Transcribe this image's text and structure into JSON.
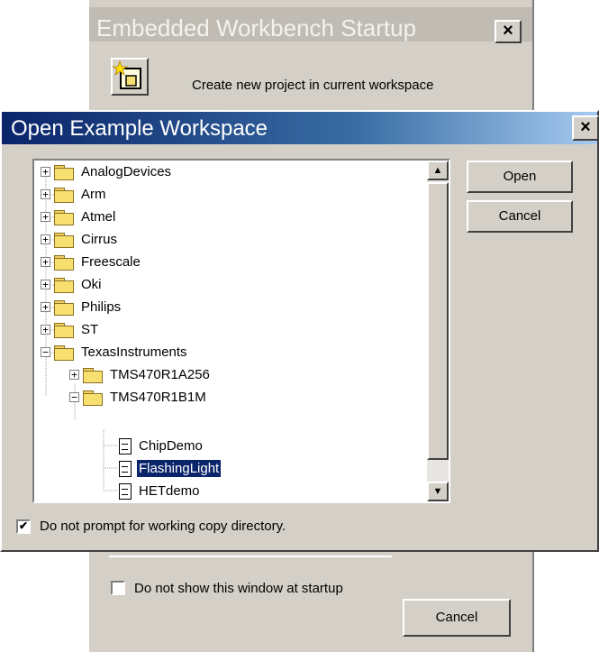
{
  "startup_dialog": {
    "title": "Embedded Workbench Startup",
    "close_label": "×",
    "create_project_text": "Create new project in current workspace",
    "checkbox_label": "Do not show this window at startup",
    "checkbox_checked": false,
    "cancel_label": "Cancel"
  },
  "example_dialog": {
    "title": "Open Example Workspace",
    "close_label": "×",
    "tree": {
      "items": [
        {
          "label": "AnalogDevices",
          "expander": "+"
        },
        {
          "label": "Arm",
          "expander": "+"
        },
        {
          "label": "Atmel",
          "expander": "+"
        },
        {
          "label": "Cirrus",
          "expander": "+"
        },
        {
          "label": "Freescale",
          "expander": "+"
        },
        {
          "label": "Oki",
          "expander": "+"
        },
        {
          "label": "Philips",
          "expander": "+"
        },
        {
          "label": "ST",
          "expander": "+"
        },
        {
          "label": "TexasInstruments",
          "expander": "−"
        },
        {
          "label": "TMS470R1A256",
          "expander": "+"
        },
        {
          "label": "TMS470R1B1M",
          "expander": "−"
        },
        {
          "label": "ChipDemo"
        },
        {
          "label": "FlashingLight",
          "selected": true
        },
        {
          "label": "HETdemo"
        }
      ]
    },
    "scroll_up": "▲",
    "scroll_down": "▼",
    "open_label": "Open",
    "cancel_label": "Cancel",
    "checkbox_label": "Do not prompt for working copy directory.",
    "checkbox_checked": true,
    "checkbox_mark": "✔"
  }
}
